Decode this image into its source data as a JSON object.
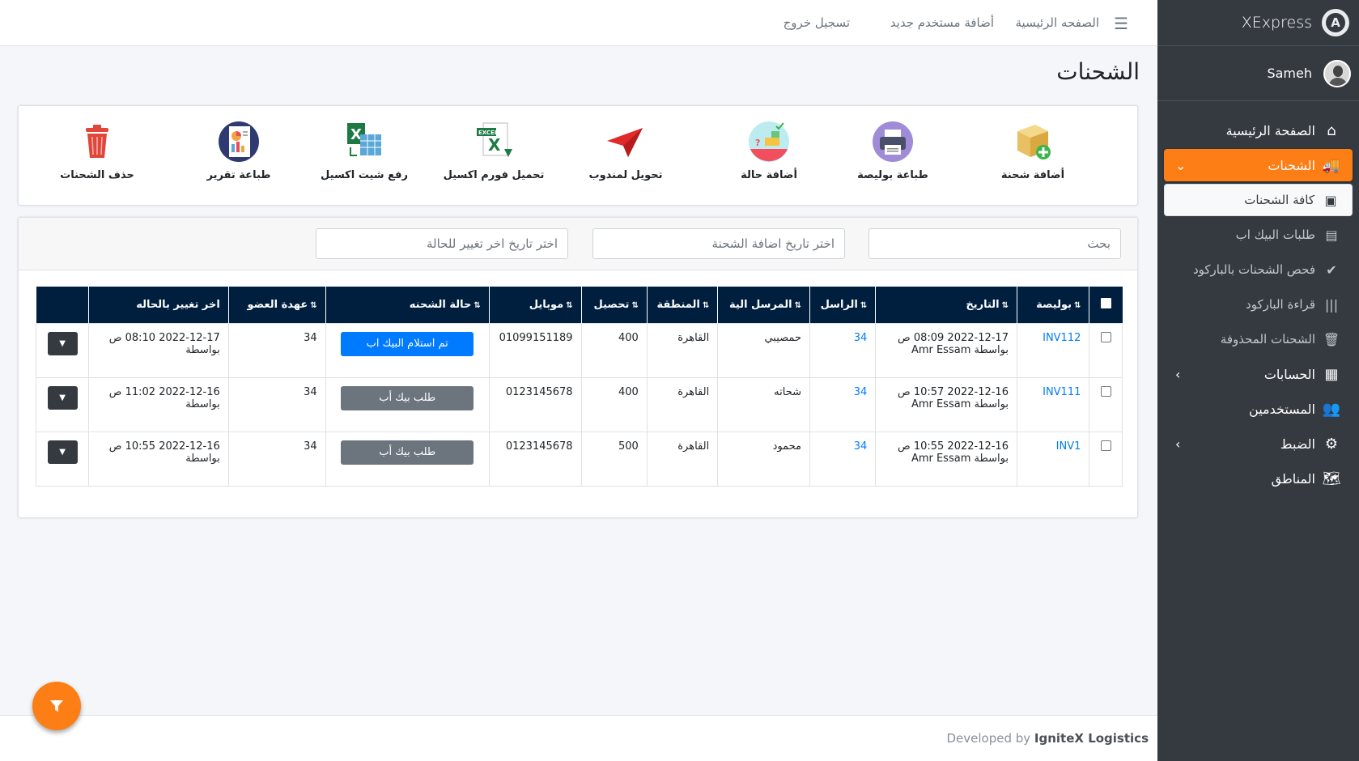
{
  "brand": {
    "name": "XExpress",
    "logo_letter": "A"
  },
  "user": {
    "name": "Sameh"
  },
  "sidebar": {
    "items": [
      {
        "label": "الصفحة الرئيسية",
        "icon": "home-icon"
      },
      {
        "label": "الشحنات",
        "icon": "truck-icon",
        "active": true
      },
      {
        "label": "كافة الشحنات",
        "icon": "box-icon",
        "sub": true,
        "active": true
      },
      {
        "label": "طلبات البيك اب",
        "icon": "bus-icon",
        "sub": true
      },
      {
        "label": "فحص الشحنات بالباركود",
        "icon": "check-circle-icon",
        "sub": true
      },
      {
        "label": "قراءة الباركود",
        "icon": "barcode-icon",
        "sub": true
      },
      {
        "label": "الشحنات المحذوفة",
        "icon": "trash-icon",
        "sub": true
      },
      {
        "label": "الحسابات",
        "icon": "calculator-icon"
      },
      {
        "label": "المستخدمين",
        "icon": "users-icon"
      },
      {
        "label": "الضبط",
        "icon": "cog-icon"
      },
      {
        "label": "المناطق",
        "icon": "map-icon"
      }
    ]
  },
  "topbar": {
    "home": "الصفحه الرئيسية",
    "add_user": "أضافة مستخدم جديد",
    "logout": "تسجيل خروج"
  },
  "page": {
    "title": "الشحنات"
  },
  "tools": {
    "add_shipment": "أضافة شحنة",
    "print_policy": "طباعة بوليصة",
    "add_status": "أضافة حالة",
    "assign_courier": "تحويل لمندوب",
    "download_excel_form": "تحميل فورم اكسيل",
    "upload_excel": "رفع شيت اكسيل",
    "print_report": "طباعة تقرير",
    "delete_shipments": "حذف الشحنات"
  },
  "filters": {
    "search_placeholder": "بحث",
    "added_date_placeholder": "اختر تاريخ اضافة الشحنة",
    "status_date_placeholder": "اختر تاريخ اخر تغيير للحالة"
  },
  "table": {
    "headers": {
      "policy": "بوليصة",
      "date": "التاريخ",
      "sender": "الراسل",
      "recipient": "المرسل الية",
      "region": "المنطقة",
      "collection": "تحصيل",
      "mobile": "موبايل",
      "status": "حالة الشحنه",
      "member": "عهدة العضو",
      "last_change": "اخر تغيير بالحاله"
    },
    "rows": [
      {
        "policy": "INV112",
        "date": "2022-12-17 08:09 ص",
        "by": "بواسطة Amr Essam",
        "sender": "34",
        "recipient": "حمصيبي",
        "region": "القاهرة",
        "collection": "400",
        "mobile": "01099151189",
        "status": "تم استلام البيك اب",
        "status_type": "primary",
        "member": "34",
        "last_change": "2022-12-17 08:10 ص",
        "last_change_by": "بواسطة"
      },
      {
        "policy": "INV111",
        "date": "2022-12-16 10:57 ص",
        "by": "بواسطة Amr Essam",
        "sender": "34",
        "recipient": "شحاته",
        "region": "القاهرة",
        "collection": "400",
        "mobile": "0123145678",
        "status": "طلب بيك أب",
        "status_type": "secondary",
        "member": "34",
        "last_change": "2022-12-16 11:02 ص",
        "last_change_by": "بواسطة"
      },
      {
        "policy": "INV1",
        "date": "2022-12-16 10:55 ص",
        "by": "بواسطة Amr Essam",
        "sender": "34",
        "recipient": "محمود",
        "region": "القاهرة",
        "collection": "500",
        "mobile": "0123145678",
        "status": "طلب بيك أب",
        "status_type": "secondary",
        "member": "34",
        "last_change": "2022-12-16 10:55 ص",
        "last_change_by": "بواسطة"
      }
    ]
  },
  "footer": {
    "prefix": "Developed by",
    "company": "IgniteX Logistics"
  },
  "colors": {
    "accent": "#fd7e14",
    "sidebar": "#343a40",
    "table_header": "#001f3f",
    "primary": "#007bff",
    "secondary": "#6c757d"
  }
}
